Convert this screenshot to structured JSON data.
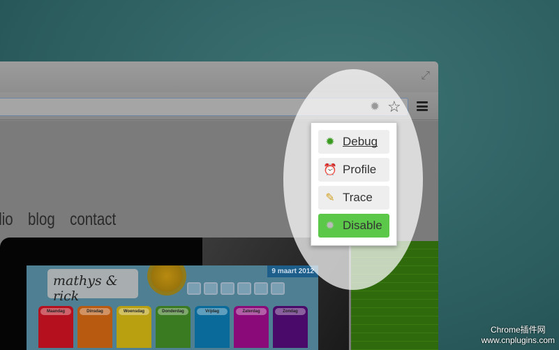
{
  "window": {
    "fullscreen_icon": "expand-icon"
  },
  "toolbar": {
    "extension_icon": "bug-icon",
    "bookmark_icon": "star-icon",
    "menu_icon": "hamburger-icon"
  },
  "page": {
    "nav": [
      "tfolio",
      "blog",
      "contact"
    ],
    "app": {
      "logo": "mathys & rick",
      "date": "9 maart 2012",
      "days": [
        {
          "name": "Maandag",
          "color": "#b5101e"
        },
        {
          "name": "Dinsdag",
          "color": "#b85a10"
        },
        {
          "name": "Woensdag",
          "color": "#b8a010"
        },
        {
          "name": "Donderdag",
          "color": "#3a7a20"
        },
        {
          "name": "Vrijdag",
          "color": "#0a6a9a"
        },
        {
          "name": "Zaterdag",
          "color": "#8a0a7a"
        },
        {
          "name": "Zondag",
          "color": "#4a0a6a"
        }
      ]
    }
  },
  "popup": {
    "items": [
      {
        "label": "Debug",
        "mnemonic": "D",
        "icon": "bug-icon"
      },
      {
        "label": "Profile",
        "mnemonic": "P",
        "icon": "alarm-clock-icon"
      },
      {
        "label": "Trace",
        "mnemonic": "T",
        "icon": "notepad-pencil-icon"
      },
      {
        "label": "Disable",
        "mnemonic": "s",
        "icon": "gray-bug-icon",
        "selected": true,
        "color": "#5cc84a"
      }
    ]
  },
  "watermark": {
    "line1": "Chrome插件网",
    "line2": "www.cnplugins.com"
  }
}
